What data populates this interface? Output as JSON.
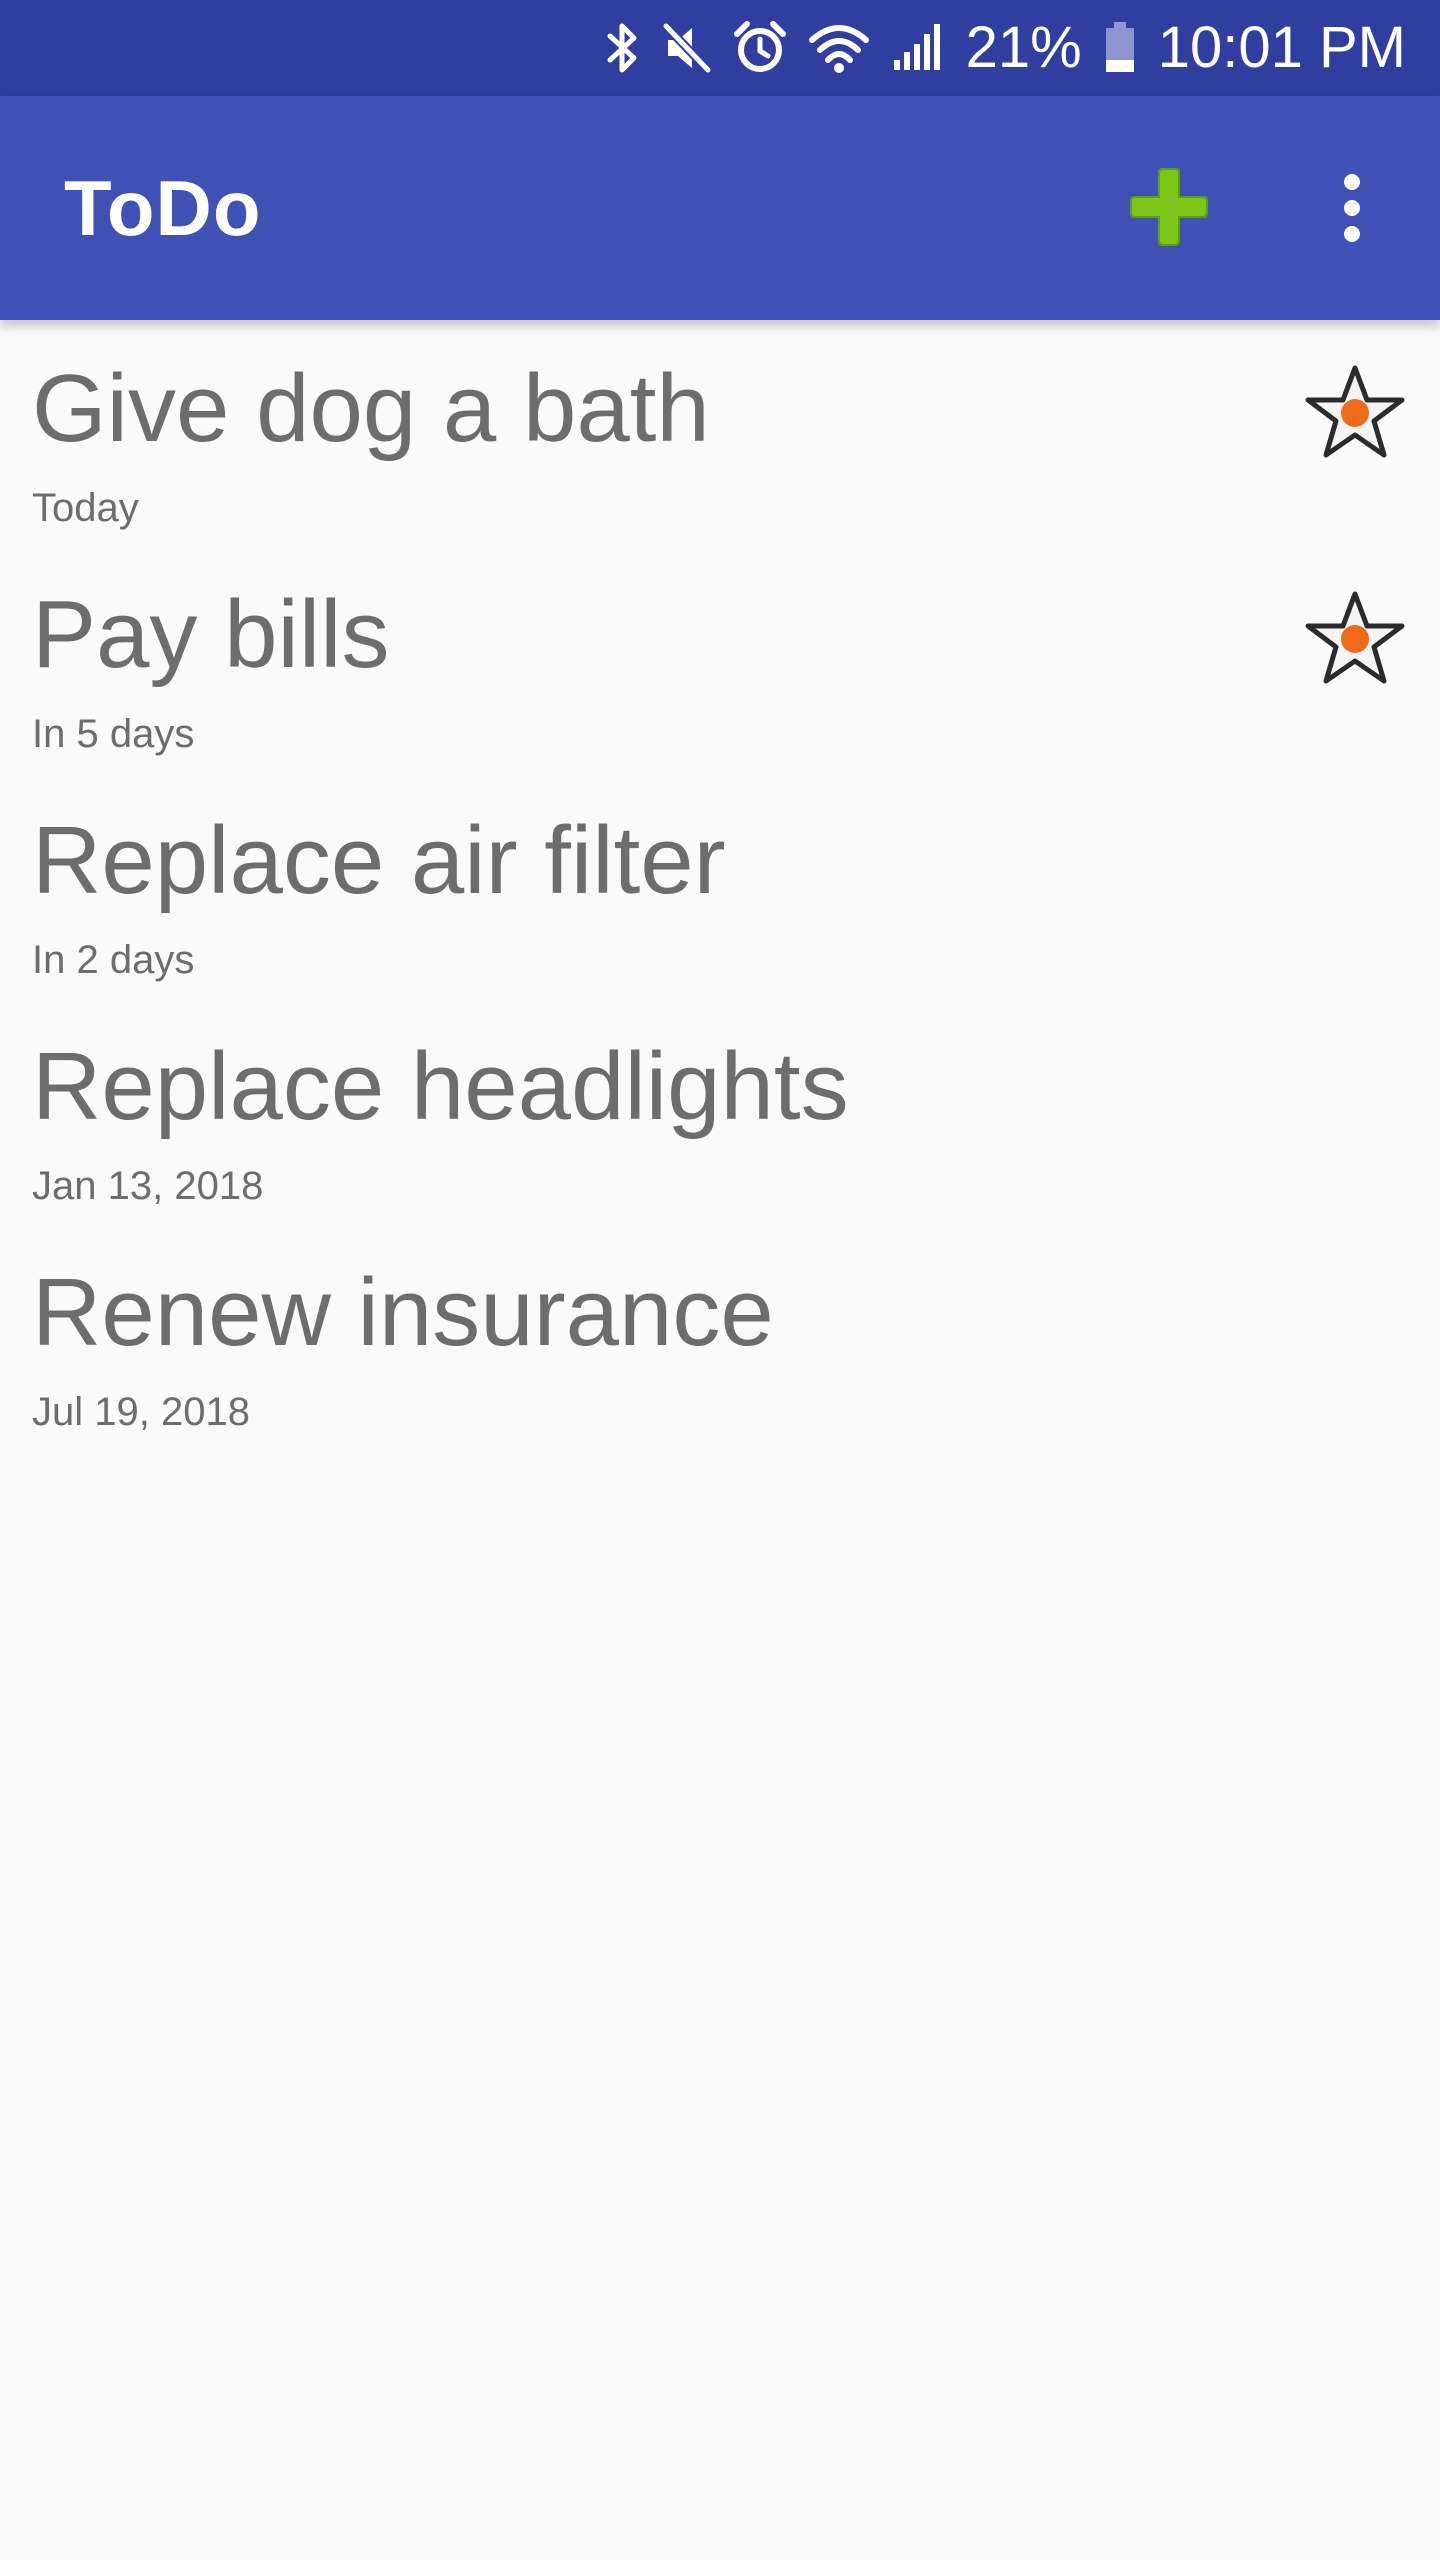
{
  "status_bar": {
    "battery_text": "21%",
    "time": "10:01 PM",
    "icons": [
      "bluetooth-icon",
      "mute-icon",
      "alarm-icon",
      "wifi-icon",
      "signal-icon",
      "battery-icon"
    ]
  },
  "app_bar": {
    "title": "ToDo",
    "add_icon": "plus-icon",
    "overflow_icon": "more-vert-icon"
  },
  "colors": {
    "status_bar": "#303f9f",
    "app_bar": "#3f51b5",
    "add_icon": "#7cc61a",
    "star_dot": "#f06a1c",
    "text": "#6d6d6d",
    "background": "#fafafa"
  },
  "todos": [
    {
      "title": "Give dog a bath",
      "date": "Today",
      "starred": true
    },
    {
      "title": "Pay bills",
      "date": "In 5 days",
      "starred": true
    },
    {
      "title": "Replace air filter",
      "date": "In 2 days",
      "starred": false
    },
    {
      "title": "Replace headlights",
      "date": "Jan 13, 2018",
      "starred": false
    },
    {
      "title": "Renew insurance",
      "date": "Jul 19, 2018",
      "starred": false
    }
  ]
}
